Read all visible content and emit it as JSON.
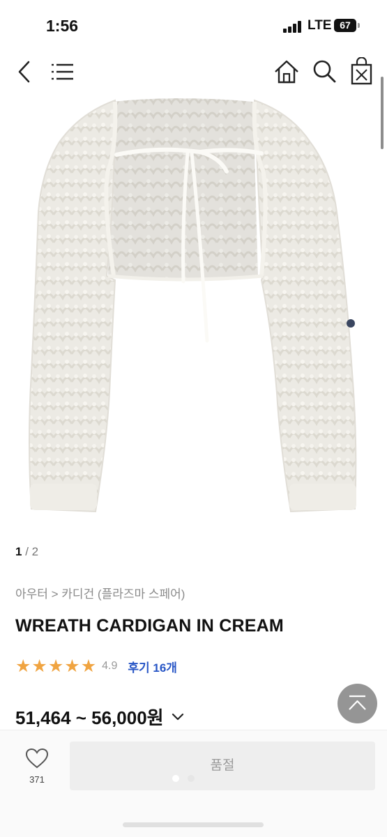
{
  "status_bar": {
    "time": "1:56",
    "network": "LTE",
    "battery": "67"
  },
  "nav": {
    "back_icon": "chevron-left-icon",
    "menu_icon": "hamburger-menu-icon",
    "home_icon": "home-icon",
    "search_icon": "search-icon",
    "cart_icon": "shopping-bag-icon"
  },
  "product": {
    "image_pager": {
      "current": "1",
      "separator": " / ",
      "total": "2"
    },
    "breadcrumb": "아우터 > 카디건 (플라즈마 스페어)",
    "title": "WREATH CARDIGAN IN CREAM",
    "rating": {
      "stars": 5,
      "score": "4.9",
      "reviews_label": "후기 16개"
    },
    "price": "51,464 ~ 56,000원"
  },
  "bottom_bar": {
    "wish_count": "371",
    "soldout_label": "품절"
  },
  "colors": {
    "star": "#f0a441",
    "review_link": "#2856c6",
    "soldout_bg": "#eeeeee"
  }
}
